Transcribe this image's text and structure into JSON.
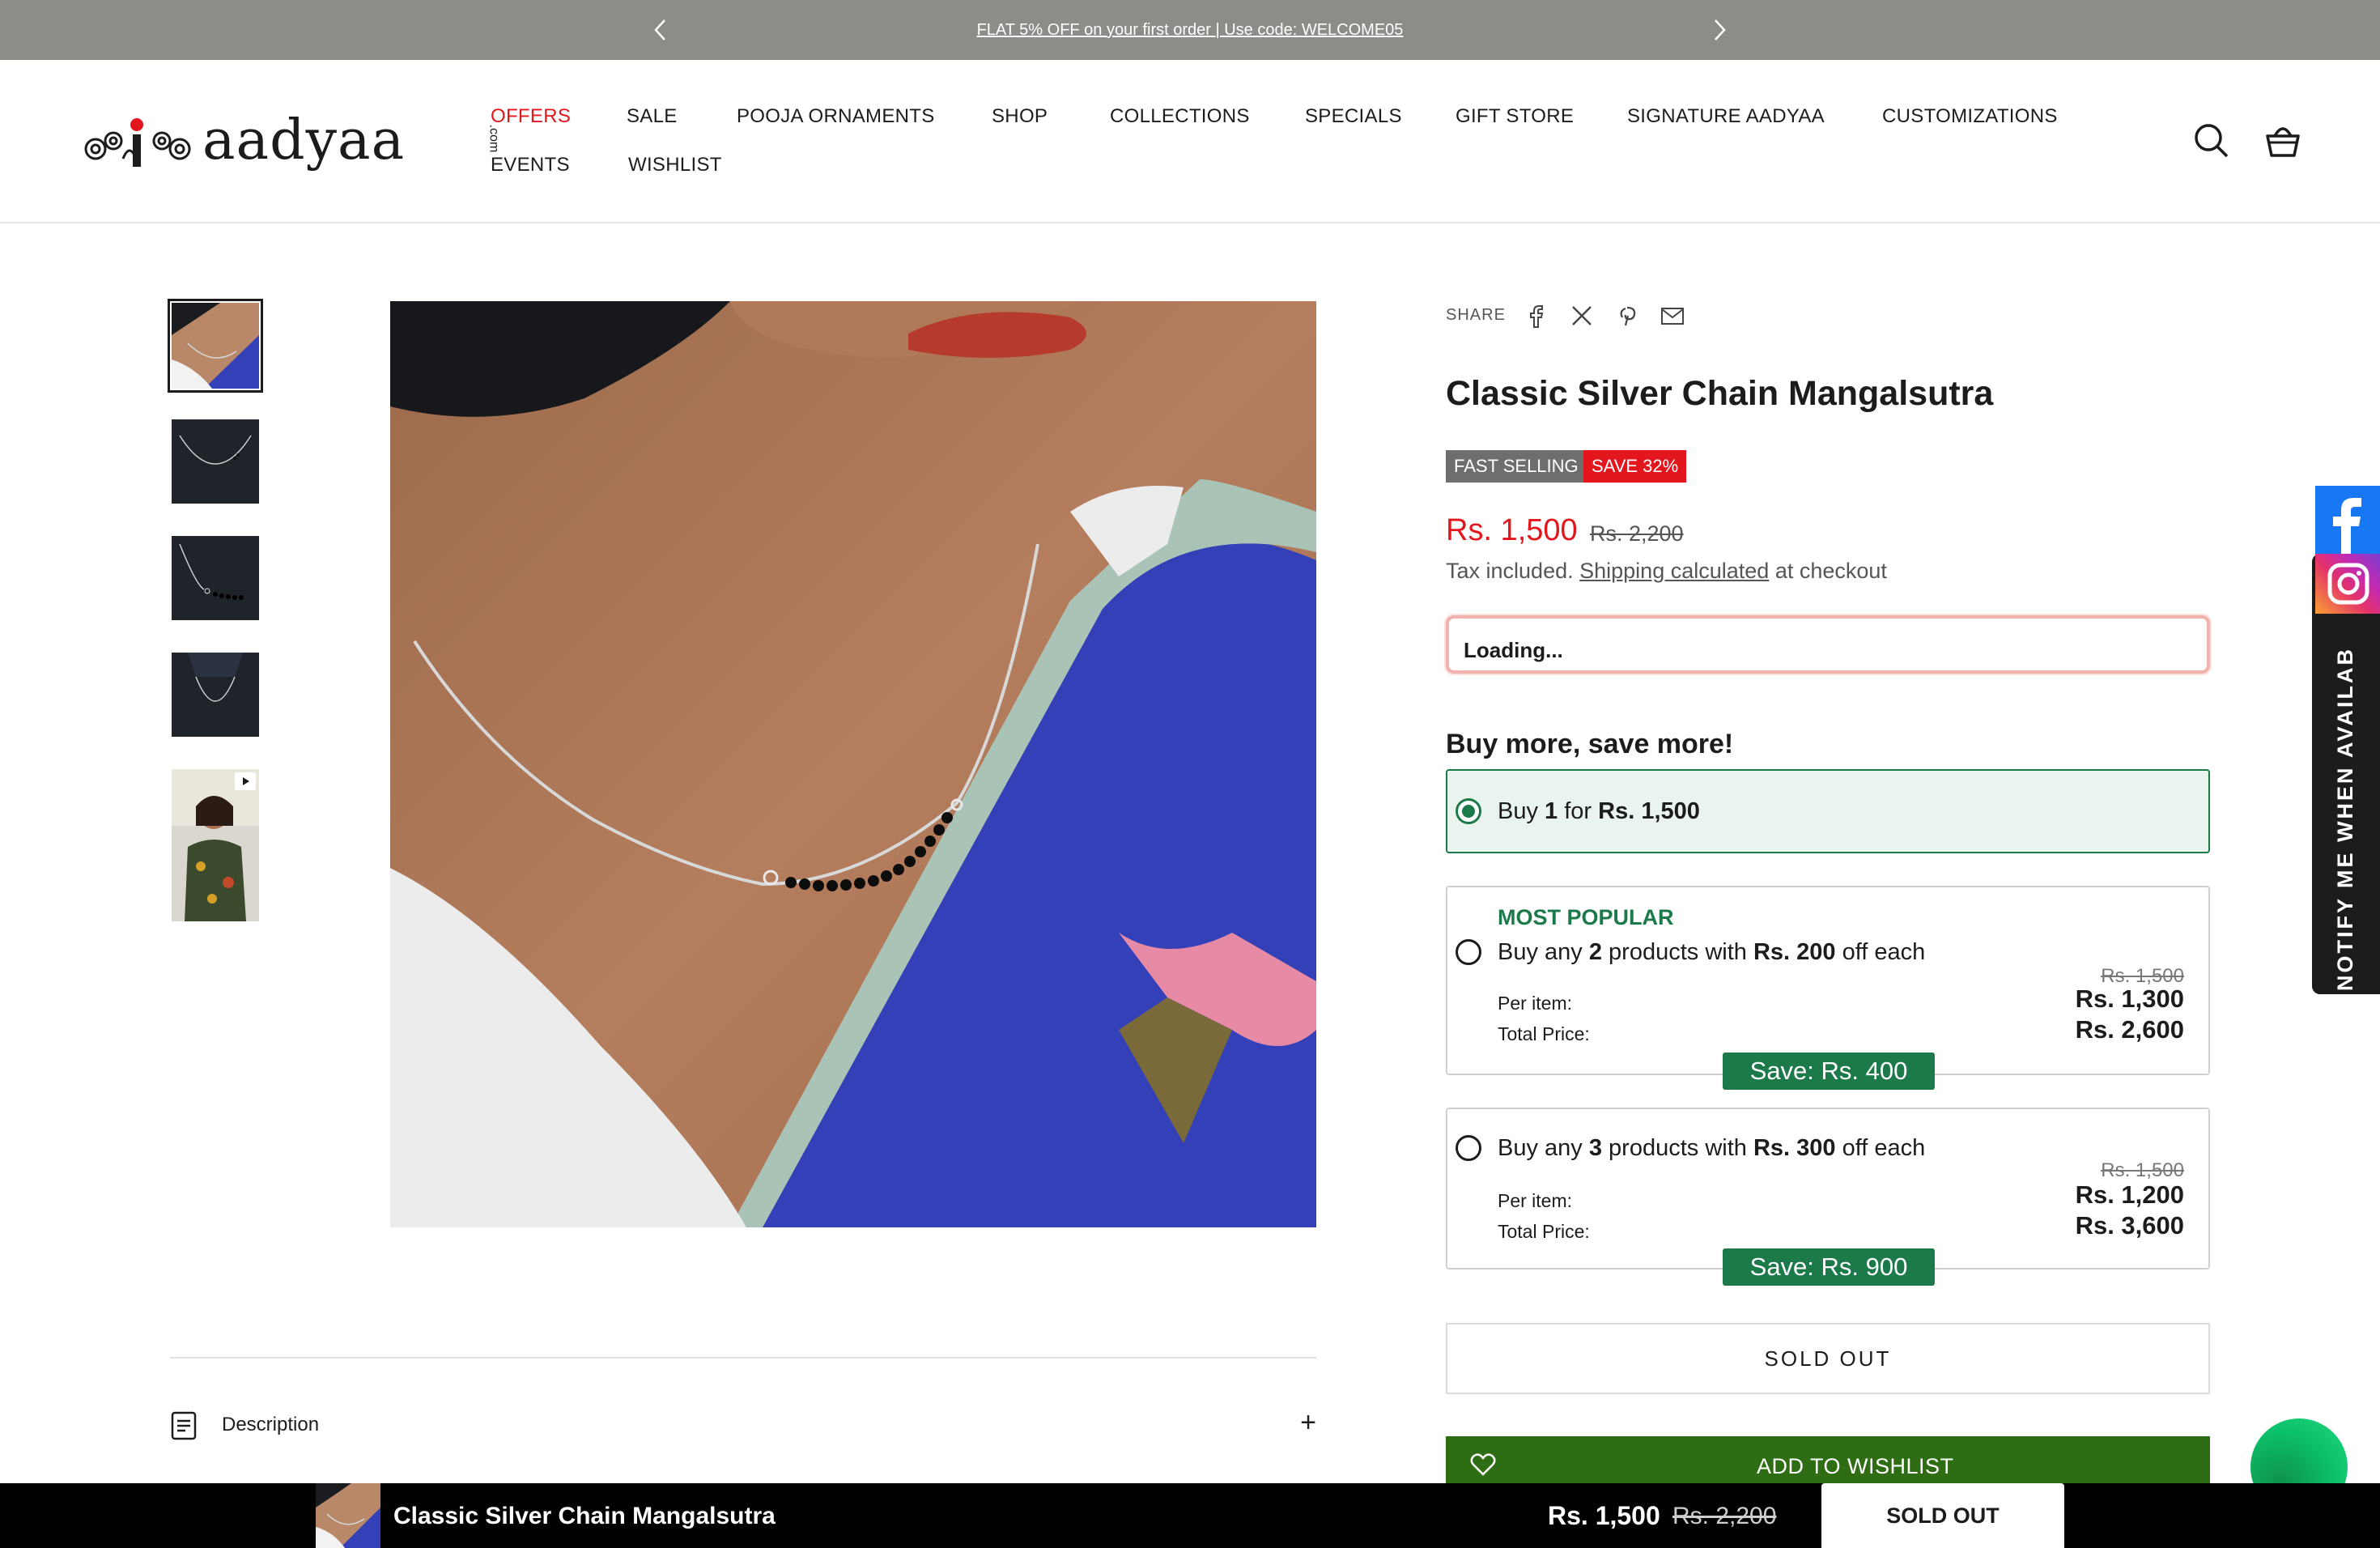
{
  "announcement": {
    "message": "FLAT 5% OFF on your first order | Use code: WELCOME05",
    "prev_icon": "chevron-left-icon",
    "next_icon": "chevron-right-icon"
  },
  "header": {
    "brand": "aadyaa",
    "brand_suffix": ".com",
    "nav": [
      "OFFERS",
      "SALE",
      "POOJA ORNAMENTS",
      "SHOP",
      "COLLECTIONS",
      "SPECIALS",
      "GIFT STORE",
      "SIGNATURE AADYAA",
      "CUSTOMIZATIONS",
      "EVENTS",
      "WISHLIST"
    ],
    "accent_color": "#e3161d",
    "icons": [
      "search-icon",
      "basket-icon"
    ]
  },
  "product": {
    "share_label": "SHARE",
    "share_icons": [
      "facebook-icon",
      "x-icon",
      "pinterest-icon",
      "email-icon"
    ],
    "title": "Classic Silver Chain Mangalsutra",
    "badges": [
      "FAST SELLING",
      "SAVE 32%"
    ],
    "price": "Rs. 1,500",
    "compare_price": "Rs. 2,200",
    "tax_prefix": "Tax included.",
    "shipping_link": "Shipping calculated",
    "tax_suffix": "at checkout",
    "loading": "Loading..."
  },
  "bundles": {
    "heading": "Buy more, save more!",
    "tier1": {
      "pre": "Buy ",
      "qty": "1",
      "mid": " for ",
      "price": "Rs. 1,500"
    },
    "tier2": {
      "popular": "MOST POPULAR",
      "pre": "Buy any ",
      "qty": "2",
      "mid": " products with ",
      "off": "Rs. 200",
      "post": " off each",
      "per_item_label": "Per item:",
      "total_label": "Total Price:",
      "strike": "Rs. 1,500",
      "per_item": "Rs. 1,300",
      "total": "Rs. 2,600",
      "save": "Save: Rs. 400"
    },
    "tier3": {
      "pre": "Buy any ",
      "qty": "3",
      "mid": " products with ",
      "off": "Rs. 300",
      "post": " off each",
      "per_item_label": "Per item:",
      "total_label": "Total Price:",
      "strike": "Rs. 1,500",
      "per_item": "Rs. 1,200",
      "total": "Rs. 3,600",
      "save": "Save: Rs. 900"
    },
    "selected_color": "#1c7a4a"
  },
  "actions": {
    "sold_out": "SOLD OUT",
    "wishlist": "ADD TO WISHLIST",
    "wishlist_color": "#2f6d14"
  },
  "accordion": {
    "description": "Description"
  },
  "side": {
    "notify": "NOTIFY ME WHEN AVAILAB"
  },
  "sticky": {
    "name": "Classic Silver Chain Mangalsutra",
    "price": "Rs. 1,500",
    "compare": "Rs. 2,200",
    "button": "SOLD OUT"
  }
}
